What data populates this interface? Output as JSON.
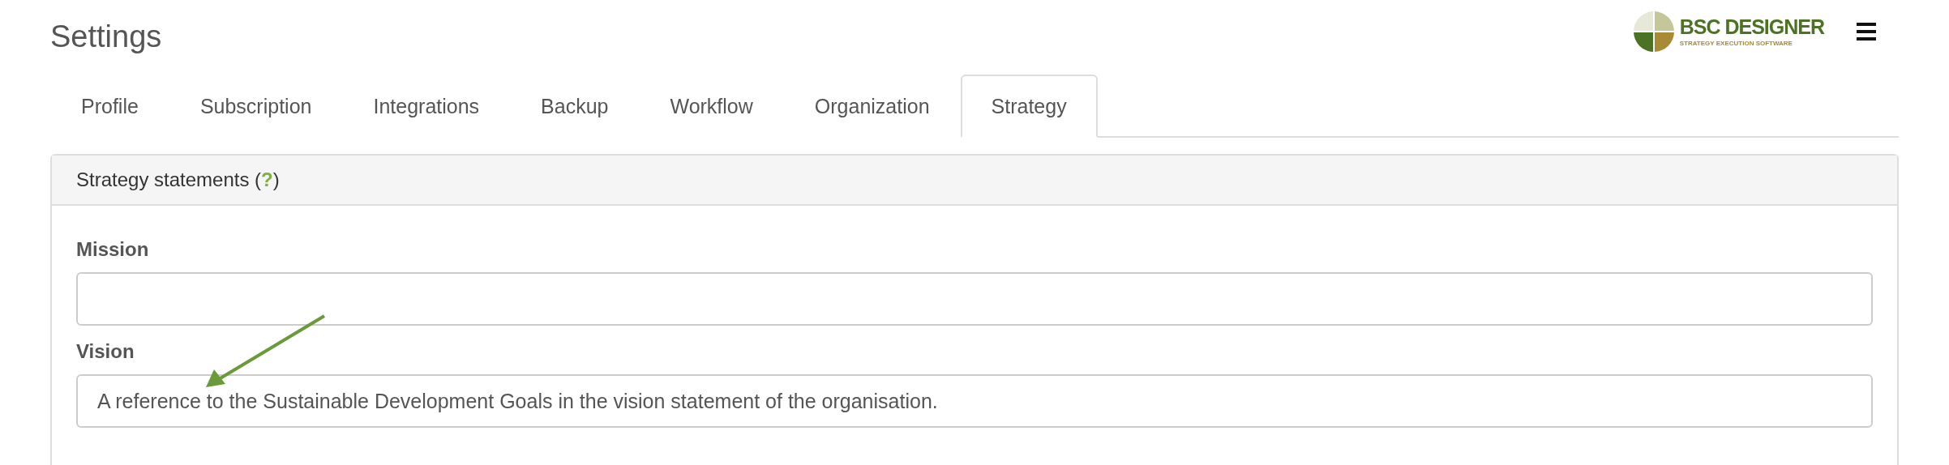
{
  "page": {
    "title": "Settings"
  },
  "logo": {
    "name": "BSC DESIGNER",
    "tagline": "STRATEGY EXECUTION SOFTWARE"
  },
  "tabs": [
    {
      "label": "Profile",
      "selected": false
    },
    {
      "label": "Subscription",
      "selected": false
    },
    {
      "label": "Integrations",
      "selected": false
    },
    {
      "label": "Backup",
      "selected": false
    },
    {
      "label": "Workflow",
      "selected": false
    },
    {
      "label": "Organization",
      "selected": false
    },
    {
      "label": "Strategy",
      "selected": true
    }
  ],
  "panel": {
    "heading_before": "Strategy statements (",
    "help_link": "?",
    "heading_after": ")",
    "fields": [
      {
        "label": "Mission"
      },
      {
        "label": "Vision",
        "value": "A reference to the Sustainable Development Goals in the vision statement of the organisation."
      }
    ]
  }
}
